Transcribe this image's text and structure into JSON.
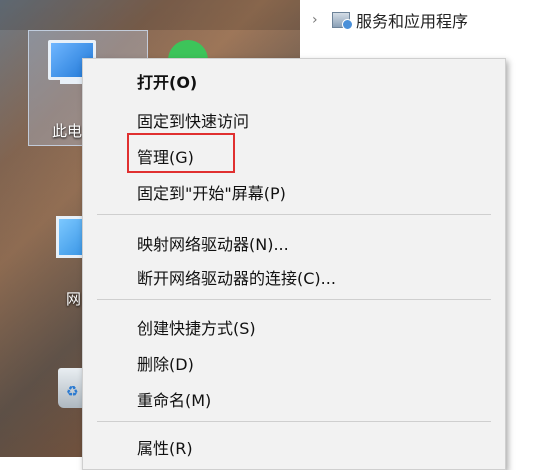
{
  "tree": {
    "label": "服务和应用程序",
    "chevron": "›"
  },
  "desktop": {
    "this_pc_label": "此电",
    "network_label": "网"
  },
  "menu": {
    "items": [
      "打开(O)",
      "固定到快速访问",
      "管理(G)",
      "固定到\"开始\"屏幕(P)",
      "映射网络驱动器(N)...",
      "断开网络驱动器的连接(C)...",
      "创建快捷方式(S)",
      "删除(D)",
      "重命名(M)",
      "属性(R)"
    ]
  },
  "colors": {
    "menu_background": "#f2f2f2",
    "highlight_border": "#e03030"
  }
}
